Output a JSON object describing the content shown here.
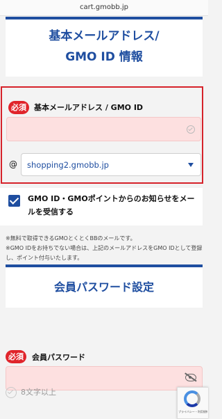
{
  "browser": {
    "url": "cart.gmobb.jp"
  },
  "section_email": {
    "title_line1": "基本メールアドレス/",
    "title_line2": "GMO ID 情報"
  },
  "email_field": {
    "required_badge": "必須",
    "label": "基本メールアドレス / GMO ID",
    "value": "",
    "at_symbol": "@",
    "domain_selected": "shopping2.gmobb.jp"
  },
  "notice_option": {
    "checked": true,
    "label": "GMO ID・GMOポイントからのお知らせをメールを受信する"
  },
  "notes": [
    "※無料で取得できるGMOとくとくBBのメールです。",
    "※GMO IDをお持ちでない場合は、上記のメールアドレスをGMO IDとして登録し、ポイント付与いたします。"
  ],
  "section_password": {
    "title": "会員パスワード設定"
  },
  "password_field": {
    "required_badge": "必須",
    "label": "会員パスワード",
    "value": ""
  },
  "password_rules": [
    {
      "text": "8文字以上"
    }
  ],
  "recaptcha": {
    "text": "プライバシー・利用規約"
  },
  "colors": {
    "brand": "#1f4ea0",
    "required": "#e0242b",
    "input_error_bg": "#fde0e0"
  },
  "icons": [
    "check-circle-icon",
    "chevron-down-icon",
    "checkbox-checked-icon",
    "eye-off-icon",
    "recaptcha-logo-icon"
  ]
}
